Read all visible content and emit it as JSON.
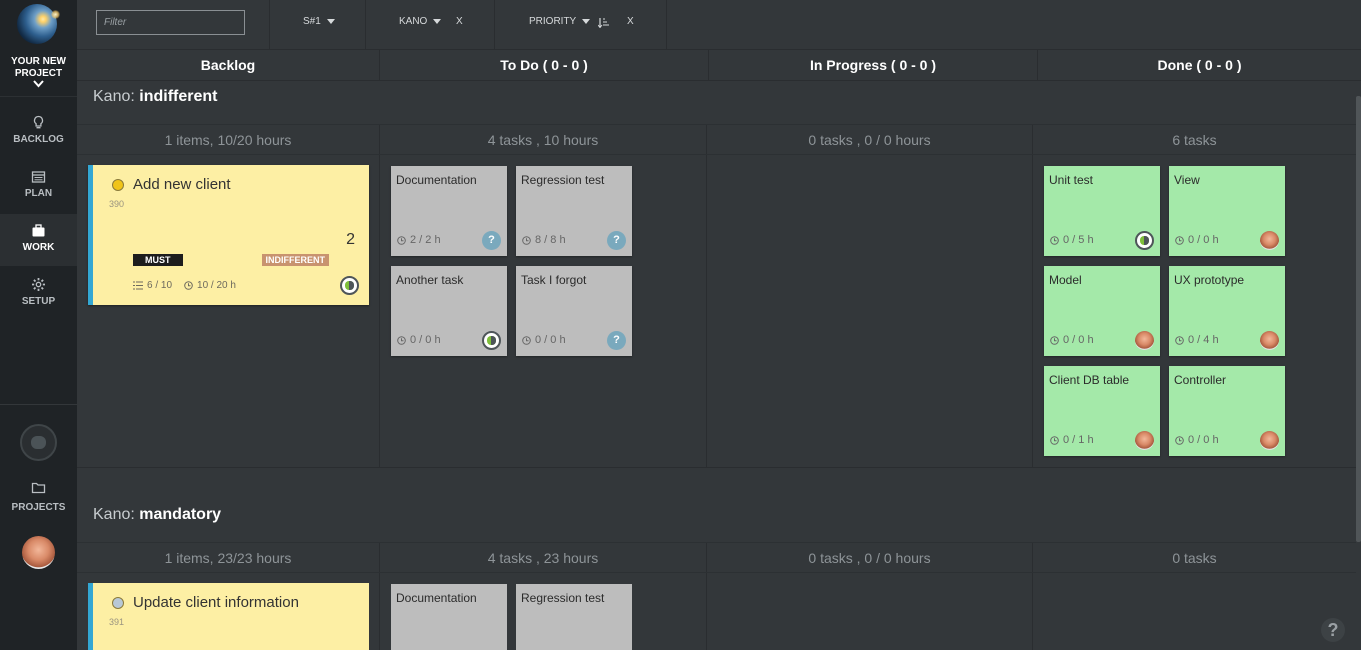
{
  "sidebar": {
    "project_name_line1": "YOUR NEW",
    "project_name_line2": "PROJECT",
    "nav": [
      {
        "label": "BACKLOG",
        "icon": "lightbulb-icon"
      },
      {
        "label": "PLAN",
        "icon": "calendar-icon"
      },
      {
        "label": "WORK",
        "icon": "briefcase-icon",
        "active": true
      },
      {
        "label": "SETUP",
        "icon": "gear-icon"
      }
    ],
    "projects_label": "PROJECTS"
  },
  "toolbar": {
    "filter_placeholder": "Filter",
    "sprint": "S#1",
    "kano": "KANO",
    "kano_clear": "X",
    "priority": "PRIORITY",
    "priority_clear": "X"
  },
  "columns": {
    "backlog": "Backlog",
    "todo": "To Do ( 0 - 0 )",
    "inprogress": "In Progress ( 0 - 0 )",
    "done": "Done ( 0 - 0 )"
  },
  "groups": [
    {
      "kano_prefix": "Kano:",
      "kano_value": "indifferent",
      "summary": {
        "backlog": "1 items, 10/20 hours",
        "todo": "4 tasks , 10 hours",
        "inprogress": "0 tasks , 0 / 0 hours",
        "done": "6 tasks"
      },
      "story": {
        "title": "Add new client",
        "id": "390",
        "points": "2",
        "priority": "MUST",
        "kano": "INDIFFERENT",
        "tasks_progress": "6 / 10",
        "hours": "10 / 20 h"
      },
      "todo_tasks": [
        {
          "title": "Documentation",
          "hours": "2 / 2 h",
          "badge": "?"
        },
        {
          "title": "Regression test",
          "hours": "8 / 8 h",
          "badge": "?"
        },
        {
          "title": "Another task",
          "hours": "0 / 0 h",
          "badge": "member"
        },
        {
          "title": "Task I forgot",
          "hours": "0 / 0 h",
          "badge": "?"
        }
      ],
      "done_tasks": [
        {
          "title": "Unit test",
          "hours": "0 / 5 h",
          "badge": "member"
        },
        {
          "title": "View",
          "hours": "0 / 0 h",
          "badge": "avatar"
        },
        {
          "title": "Model",
          "hours": "0 / 0 h",
          "badge": "avatar"
        },
        {
          "title": "UX prototype",
          "hours": "0 / 4 h",
          "badge": "avatar"
        },
        {
          "title": "Client DB table",
          "hours": "0 / 1 h",
          "badge": "avatar"
        },
        {
          "title": "Controller",
          "hours": "0 / 0 h",
          "badge": "avatar"
        }
      ]
    },
    {
      "kano_prefix": "Kano:",
      "kano_value": "mandatory",
      "summary": {
        "backlog": "1 items, 23/23 hours",
        "todo": "4 tasks , 23 hours",
        "inprogress": "0 tasks , 0 / 0 hours",
        "done": "0 tasks"
      },
      "story": {
        "title": "Update client information",
        "id": "391"
      },
      "todo_tasks": [
        {
          "title": "Documentation"
        },
        {
          "title": "Regression test"
        }
      ]
    }
  ],
  "help": "?",
  "question_badge": "?"
}
